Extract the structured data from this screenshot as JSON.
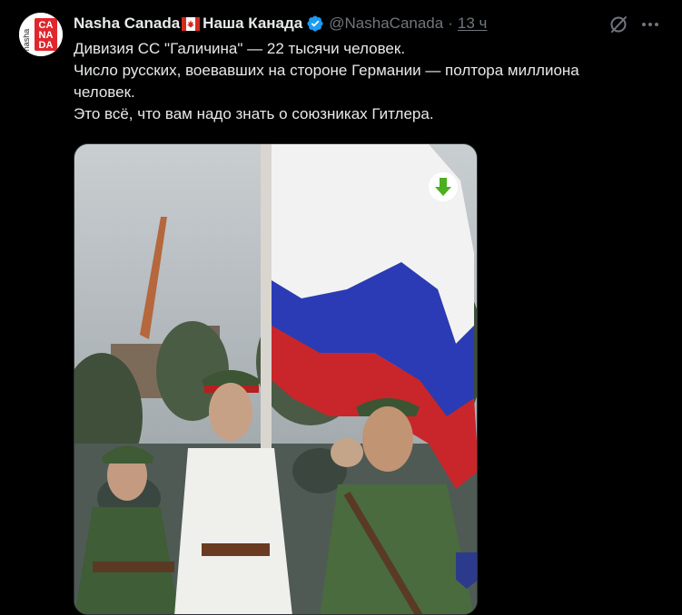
{
  "tweet": {
    "author": {
      "display_name": "Nasha Canada",
      "display_name_suffix": "Наша Канада",
      "handle": "@NashaCanada",
      "avatar_logo_lines": [
        "nasha",
        "CA",
        "NA",
        "DA"
      ],
      "verified": true
    },
    "separator": "·",
    "time": "13 ч",
    "text_lines": [
      "Дивизия СС \"Галичина\" — 22 тысячи человек.",
      "Число русских, воевавших на стороне Германии — полтора миллиона",
      "человек.",
      "Это всё, что вам надо знать о союзниках Гитлера."
    ],
    "media": {
      "description": "colorized photo",
      "flag_colors": [
        "#f2f2f2",
        "#2b3bb5",
        "#c8262b"
      ]
    }
  },
  "colors": {
    "background": "#000000",
    "text_primary": "#e7e9ea",
    "text_secondary": "#71767b",
    "verified_blue": "#1d9bf0",
    "download_green": "#4caf20",
    "avatar_red": "#e0262c"
  },
  "icons": {
    "grok": "grok-icon",
    "more": "more-dots-icon",
    "verified": "verified-badge-icon",
    "download": "download-arrow-icon",
    "flag": "canada-flag-icon"
  }
}
